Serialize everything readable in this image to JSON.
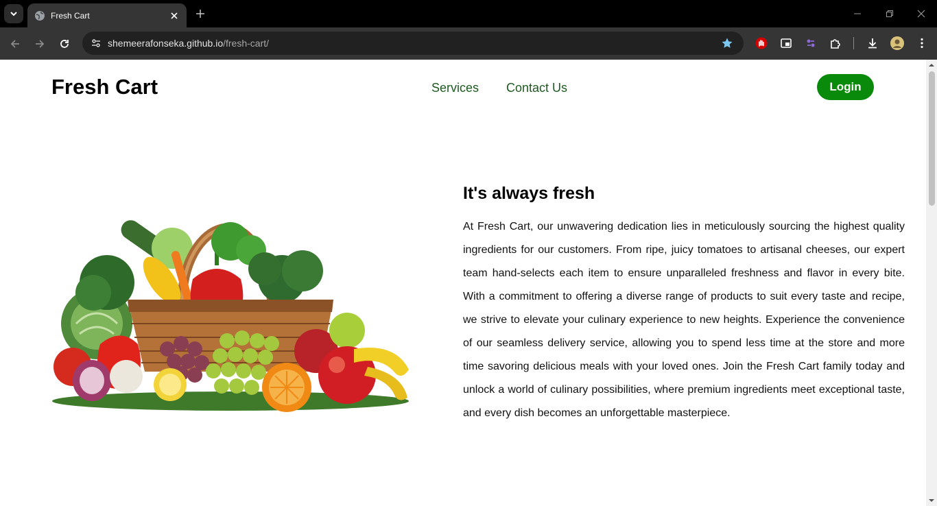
{
  "browser": {
    "tab_title": "Fresh Cart",
    "url_host": "shemeerafonseka.github.io",
    "url_path": "/fresh-cart/"
  },
  "site": {
    "logo": "Fresh Cart",
    "nav": [
      "Services",
      "Contact Us"
    ],
    "login_label": "Login",
    "accent_color": "#0a8a0a",
    "nav_color": "#1c5a1f"
  },
  "hero": {
    "heading": "It's always fresh",
    "paragraph": "At Fresh Cart, our unwavering dedication lies in meticulously sourcing the highest quality ingredients for our customers. From ripe, juicy tomatoes to artisanal cheeses, our expert team hand-selects each item to ensure unparalleled freshness and flavor in every bite. With a commitment to offering a diverse range of products to suit every taste and recipe, we strive to elevate your culinary experience to new heights. Experience the convenience of our seamless delivery service, allowing you to spend less time at the store and more time savoring delicious meals with your loved ones. Join the Fresh Cart family today and unlock a world of culinary possibilities, where premium ingredients meet exceptional taste, and every dish becomes an unforgettable masterpiece."
  }
}
